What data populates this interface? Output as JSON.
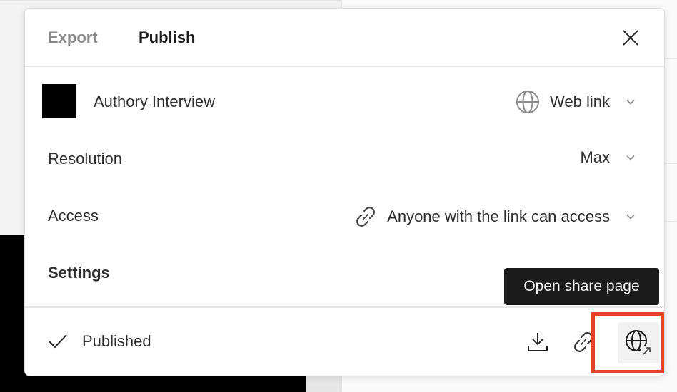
{
  "dialog": {
    "tabs": [
      {
        "label": "Export",
        "active": false
      },
      {
        "label": "Publish",
        "active": true
      }
    ],
    "close_icon": "close-icon",
    "item": {
      "title": "Authory Interview",
      "destination": {
        "icon": "globe-icon",
        "value": "Web link"
      }
    },
    "resolution": {
      "label": "Resolution",
      "value": "Max"
    },
    "access": {
      "label": "Access",
      "icon": "link-icon",
      "value": "Anyone with the link can access"
    },
    "settings": {
      "label": "Settings"
    },
    "footer": {
      "status": {
        "icon": "check-icon",
        "label": "Published"
      },
      "actions": [
        {
          "name": "download",
          "icon": "download-icon"
        },
        {
          "name": "copy-link",
          "icon": "link-icon"
        },
        {
          "name": "open-share-page",
          "icon": "globe-external-icon"
        }
      ]
    }
  },
  "tooltip": {
    "text": "Open share page"
  },
  "colors": {
    "highlight": "#e5422b",
    "tooltip_bg": "#1c1c1c",
    "inactive_tab": "#8a8a8a"
  }
}
